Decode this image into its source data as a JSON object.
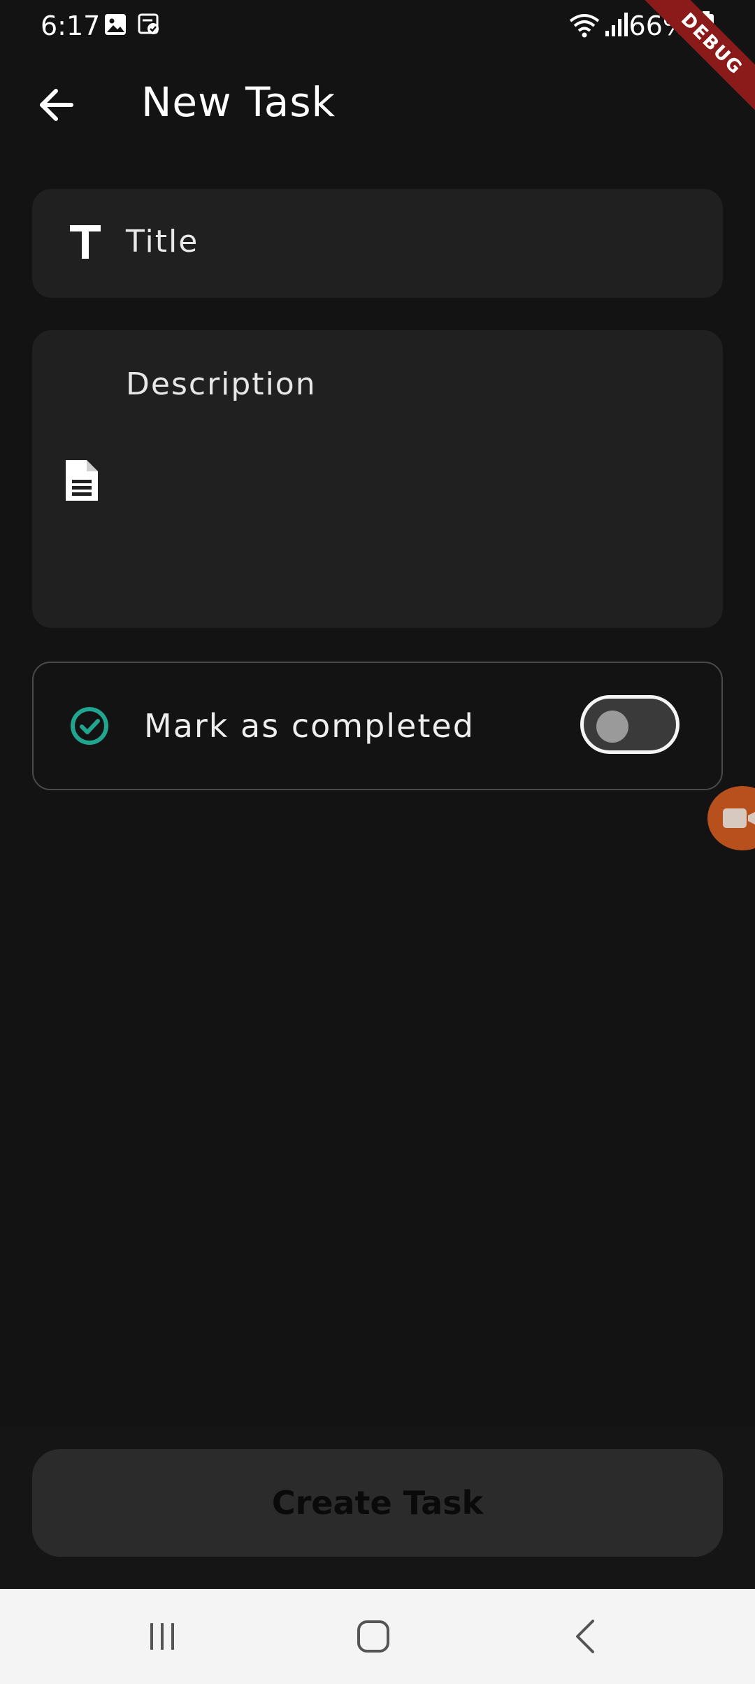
{
  "status_bar": {
    "time": "6:17",
    "battery": "66%",
    "icons": [
      "gallery-icon",
      "task-notification-icon",
      "wifi-icon",
      "signal-icon",
      "battery-icon"
    ]
  },
  "debug_banner": "DEBUG",
  "app_bar": {
    "back_icon": "arrow-back-icon",
    "title": "New Task"
  },
  "form": {
    "title_field": {
      "placeholder": "Title",
      "value": "",
      "icon": "text-t-icon"
    },
    "description_field": {
      "placeholder": "Description",
      "value": "",
      "icon": "document-icon"
    },
    "completed": {
      "label": "Mark as completed",
      "icon": "check-circle-icon",
      "enabled": false
    }
  },
  "actions": {
    "create_label": "Create Task"
  },
  "nav_bar": {
    "items": [
      "recent-apps-icon",
      "home-icon",
      "back-icon"
    ]
  },
  "colors": {
    "background": "#131313",
    "field_background": "#202020",
    "accent_teal": "#22a58f",
    "debug_ribbon": "#8b1a1a",
    "button_background": "#2b2b2b"
  }
}
